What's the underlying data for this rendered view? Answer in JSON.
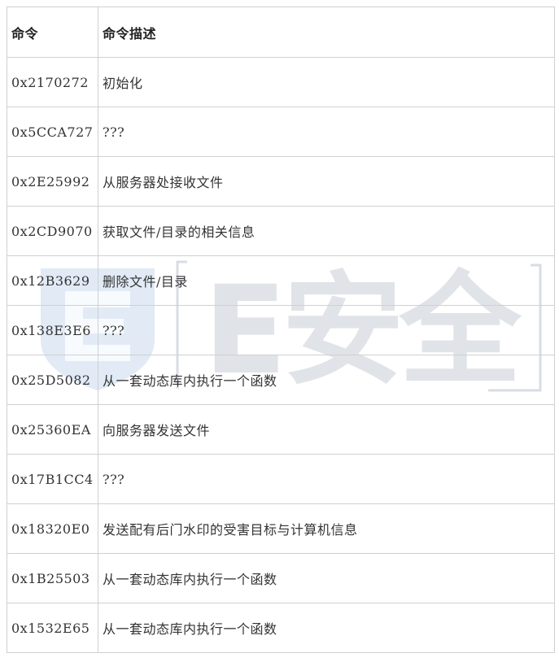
{
  "table": {
    "headers": [
      "命令",
      "命令描述"
    ],
    "rows": [
      [
        "0x2170272",
        "初始化"
      ],
      [
        "0x5CCA727",
        "???"
      ],
      [
        "0x2E25992",
        "从服务器处接收文件"
      ],
      [
        "0x2CD9070",
        "获取文件/目录的相关信息"
      ],
      [
        "0x12B3629",
        "删除文件/目录"
      ],
      [
        "0x138E3E6",
        "???"
      ],
      [
        "0x25D5082",
        "从一套动态库内执行一个函数"
      ],
      [
        "0x25360EA",
        "向服务器发送文件"
      ],
      [
        "0x17B1CC4",
        "???"
      ],
      [
        "0x18320E0",
        "发送配有后门水印的受害目标与计算机信息"
      ],
      [
        "0x1B25503",
        "从一套动态库内执行一个函数"
      ],
      [
        "0x1532E65",
        "从一套动态库内执行一个函数"
      ]
    ]
  },
  "watermark": {
    "text": "E安全",
    "color": "#c8cfd8",
    "shield_color": "#c9d9ee"
  }
}
